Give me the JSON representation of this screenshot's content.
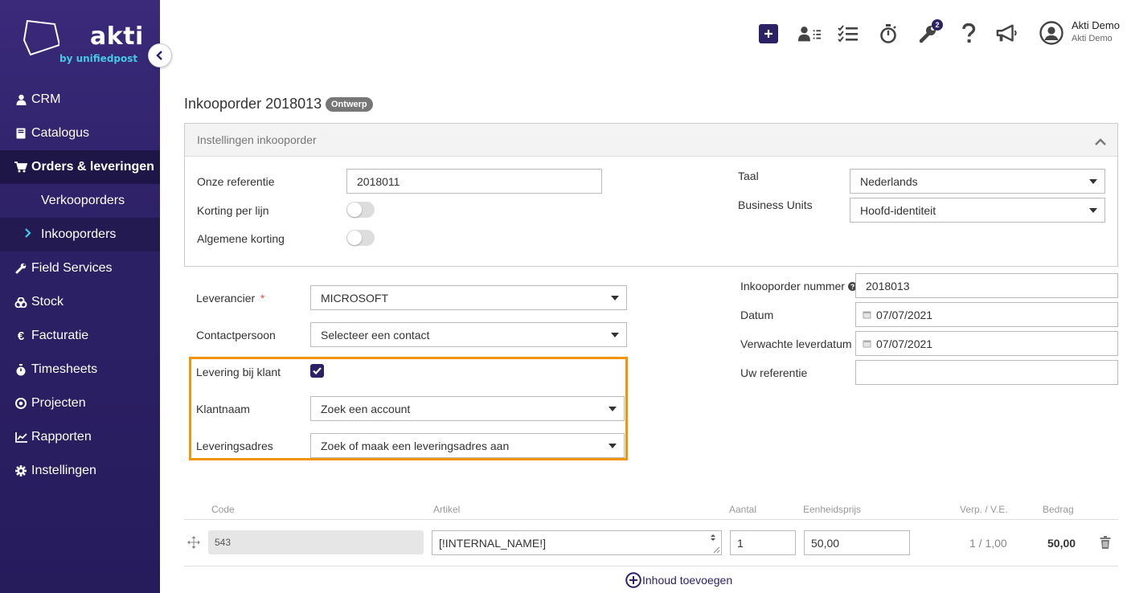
{
  "app": {
    "logo_word": "akti",
    "logo_sub": "by unifiedpost"
  },
  "sidebar": {
    "items": [
      {
        "label": "CRM",
        "icon": "user-icon"
      },
      {
        "label": "Catalogus",
        "icon": "book-icon"
      },
      {
        "label": "Orders & leveringen",
        "icon": "cart-icon",
        "active": true
      },
      {
        "label": "Field Services",
        "icon": "wrench-icon"
      },
      {
        "label": "Stock",
        "icon": "boxes-icon"
      },
      {
        "label": "Facturatie",
        "icon": "euro-icon"
      },
      {
        "label": "Timesheets",
        "icon": "stopwatch-icon"
      },
      {
        "label": "Projecten",
        "icon": "target-icon"
      },
      {
        "label": "Rapporten",
        "icon": "chart-icon"
      },
      {
        "label": "Instellingen",
        "icon": "gear-icon"
      }
    ],
    "subitems": [
      {
        "label": "Verkooporders"
      },
      {
        "label": "Inkooporders",
        "current": true
      }
    ]
  },
  "topbar": {
    "icons": [
      "plus-icon",
      "contacts-list-icon",
      "tasks-icon",
      "stopwatch-icon",
      "wrench-icon",
      "help-icon",
      "megaphone-icon",
      "user-circle-icon"
    ],
    "notification_badge": "2",
    "user_name": "Akti Demo",
    "user_company": "Akti Demo"
  },
  "page": {
    "title": "Inkooporder 2018013",
    "status": "Ontwerp"
  },
  "settings_panel": {
    "title": "Instellingen inkooporder",
    "onze_referentie_label": "Onze referentie",
    "onze_referentie_value": "2018011",
    "korting_per_lijn_label": "Korting per lijn",
    "korting_per_lijn_on": false,
    "algemene_korting_label": "Algemene korting",
    "algemene_korting_on": false,
    "taal_label": "Taal",
    "taal_value": "Nederlands",
    "business_units_label": "Business Units",
    "business_units_value": "Hoofd-identiteit"
  },
  "form": {
    "leverancier_label": "Leverancier",
    "required_mark": "*",
    "leverancier_value": "MICROSOFT",
    "contactpersoon_label": "Contactpersoon",
    "contactpersoon_placeholder": "Selecteer een contact",
    "levering_bij_klant_label": "Levering bij klant",
    "levering_bij_klant_checked": true,
    "klantnaam_label": "Klantnaam",
    "klantnaam_placeholder": "Zoek een account",
    "leveringsadres_label": "Leveringsadres",
    "leveringsadres_placeholder": "Zoek of maak een leveringsadres aan",
    "inkooporder_nummer_label": "Inkooporder nummer",
    "inkooporder_nummer_value": "2018013",
    "datum_label": "Datum",
    "datum_value": "07/07/2021",
    "verwachte_leverdatum_label": "Verwachte leverdatum",
    "verwachte_leverdatum_value": "07/07/2021",
    "uw_referentie_label": "Uw referentie",
    "uw_referentie_value": ""
  },
  "lines_table": {
    "headers": {
      "code": "Code",
      "artikel": "Artikel",
      "aantal": "Aantal",
      "eenheidsprijs": "Eenheidsprijs",
      "verp": "Verp. / V.E.",
      "bedrag": "Bedrag"
    },
    "rows": [
      {
        "code": "543",
        "artikel": "[!INTERNAL_NAME!]",
        "aantal": "1",
        "eenheidsprijs": "50,00",
        "verp": "1 / 1,00",
        "bedrag": "50,00"
      }
    ],
    "add_label": "Inhoud toevoegen"
  },
  "colors": {
    "brand": "#2d2166",
    "accent": "#46c8e4",
    "highlight": "#f0950c"
  }
}
